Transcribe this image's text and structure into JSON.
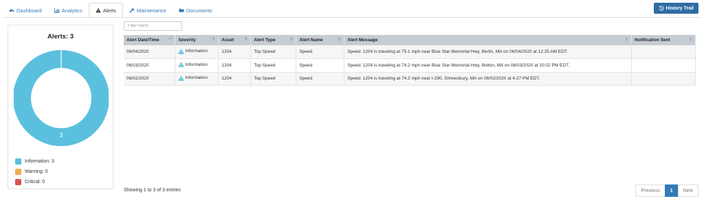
{
  "tabs": [
    {
      "label": "Dashboard",
      "icon": "dashboard-icon"
    },
    {
      "label": "Analytics",
      "icon": "bar-chart-icon"
    },
    {
      "label": "Alerts",
      "icon": "warning-icon"
    },
    {
      "label": "Maintenance",
      "icon": "wrench-icon"
    },
    {
      "label": "Documents",
      "icon": "folder-icon"
    }
  ],
  "active_tab": "Alerts",
  "history_button": {
    "label": "History Trail",
    "icon": "history-icon"
  },
  "panel": {
    "title": "Alerts: 3",
    "donut_value_label": "3",
    "legend": [
      {
        "label": "Information: 3",
        "color": "#5bc0de"
      },
      {
        "label": "Warning: 0",
        "color": "#f0ad4e"
      },
      {
        "label": "Critical: 0",
        "color": "#d9534f"
      }
    ]
  },
  "filter": {
    "placeholder": "Filter Alerts",
    "value": ""
  },
  "table": {
    "headers": [
      "Alert Date/Time",
      "Severity",
      "Asset",
      "Alert Type",
      "Alert Name",
      "Alert Message",
      "Notification Sent"
    ],
    "rows": [
      [
        "06/04/2020",
        "Information",
        "1204",
        "Top Speed",
        "Speed",
        "Speed: 1204 is traveling at 75.1 mph near Blue Star Memorial Hwy, Berlin, MA on 06/04/2020 at 12:25 AM EDT.",
        ""
      ],
      [
        "06/03/2020",
        "Information",
        "1204",
        "Top Speed",
        "Speed",
        "Speed: 1204 is traveling at 74.2 mph near Blue Star Memorial Hwy, Bolton, MA on 06/03/2020 at 10:02 PM EDT.",
        ""
      ],
      [
        "06/02/2020",
        "Information",
        "1204",
        "Top Speed",
        "Speed",
        "Speed: 1204 is traveling at 74.2 mph near I-290, Shrewsbury, MA on 06/02/2020 at 4:27 PM EDT.",
        ""
      ]
    ]
  },
  "footer": {
    "info": "Showing 1 to 3 of 3 entries"
  },
  "pagination": {
    "previous": "Previous",
    "current": "1",
    "next": "Next"
  },
  "colors": {
    "accent": "#337ab7",
    "button": "#2e6da4",
    "donut": "#5bc0de",
    "header_bg": "#c5ccd3"
  }
}
